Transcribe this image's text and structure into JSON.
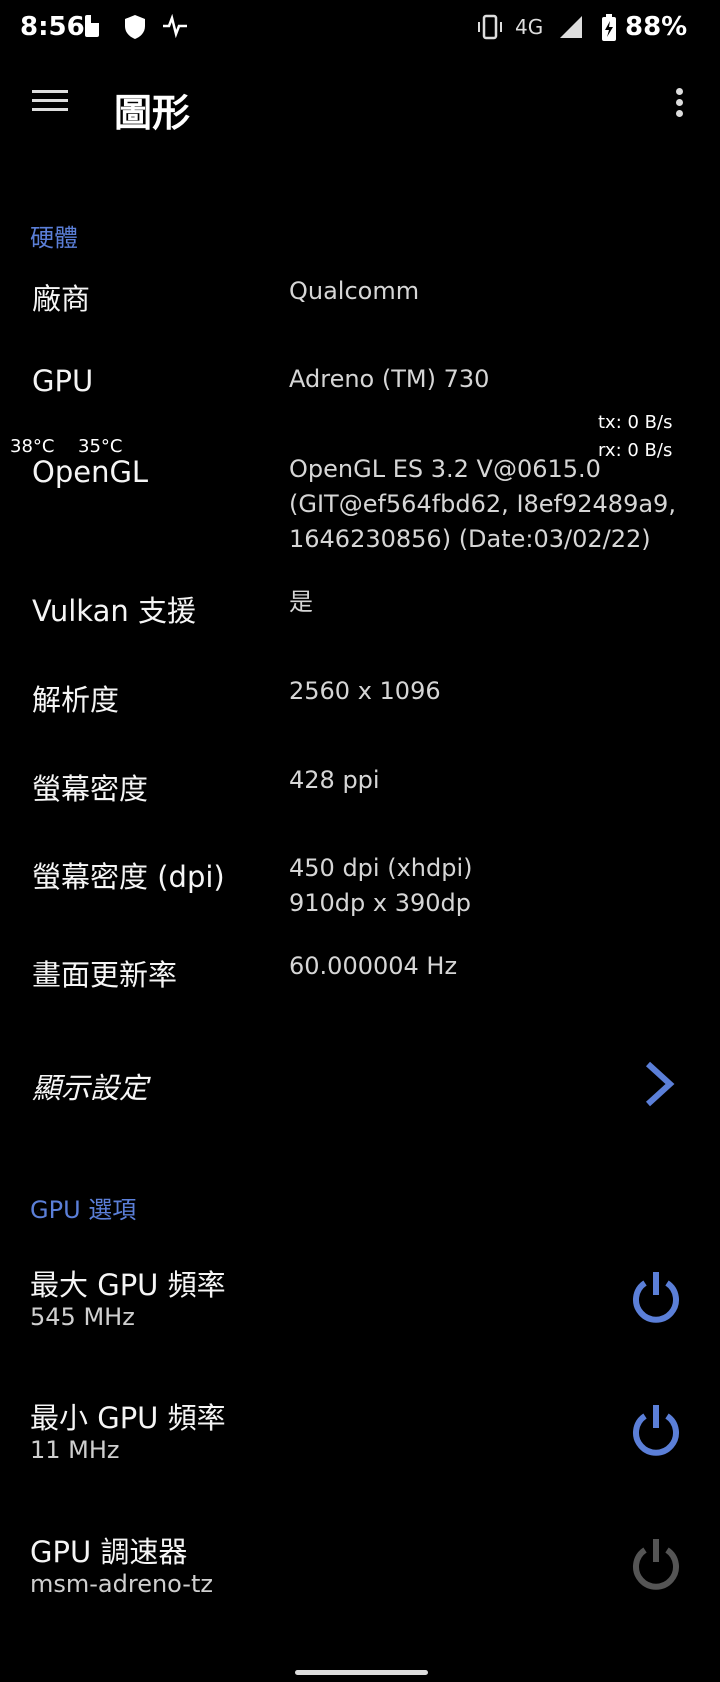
{
  "status_bar": {
    "time": "8:56",
    "network": "4G",
    "battery": "88%"
  },
  "app_bar": {
    "title": "圖形",
    "menu_icon": "hamburger-menu-icon",
    "more_icon": "more-vert-icon"
  },
  "hardware": {
    "header": "硬體",
    "rows": [
      {
        "label": "廠商",
        "value": "Qualcomm"
      },
      {
        "label": "GPU",
        "value": "Adreno (TM) 730"
      },
      {
        "label": "OpenGL",
        "value_lines": [
          "OpenGL ES 3.2 V@0615.0",
          "(GIT@ef564fbd62, I8ef92489a9,",
          "1646230856) (Date:03/02/22)"
        ]
      },
      {
        "label": "Vulkan 支援",
        "value": "是"
      },
      {
        "label": "解析度",
        "value": "2560 x 1096"
      },
      {
        "label": "螢幕密度",
        "value": "428 ppi"
      },
      {
        "label": "螢幕密度 (dpi)",
        "value_lines": [
          "450 dpi (xhdpi)",
          "910dp x 390dp"
        ]
      },
      {
        "label": "畫面更新率",
        "value": "60.000004 Hz"
      }
    ]
  },
  "display_settings": {
    "label": "顯示設定",
    "icon": "chevron-right-icon"
  },
  "overlay": {
    "temp1": "38°C",
    "temp2": "35°C",
    "tx": "tx: 0 B/s",
    "rx": "rx: 0 B/s"
  },
  "gpu_options": {
    "header": "GPU 選項",
    "items": [
      {
        "label": "最大 GPU 頻率",
        "value": "545 MHz",
        "icon": "power-icon",
        "color": "#5b7fd8"
      },
      {
        "label": "最小 GPU 頻率",
        "value": "11 MHz",
        "icon": "power-icon",
        "color": "#5b7fd8"
      },
      {
        "label": "GPU 調速器",
        "value": "msm-adreno-tz",
        "icon": "power-icon",
        "color": "#555555"
      }
    ]
  },
  "colors": {
    "accent": "#5b7fd8",
    "background": "#000000"
  }
}
